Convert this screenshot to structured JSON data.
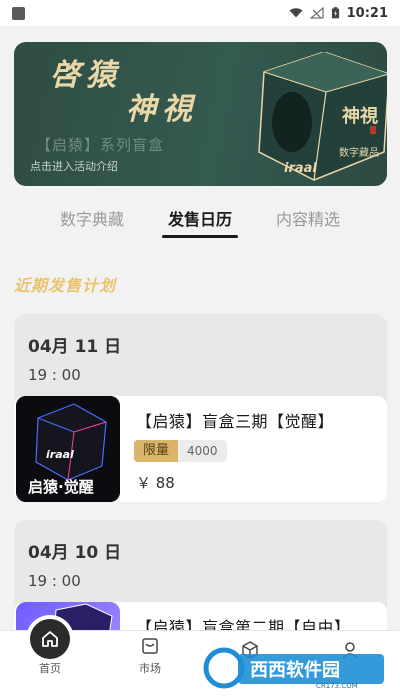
{
  "status_bar": {
    "time": "10:21"
  },
  "banner": {
    "title_line1": "啓猿",
    "title_line2": "神視",
    "subtitle": "【启猿】系列盲盒",
    "hint": "点击进入活动介绍",
    "cube_text_1": "神視",
    "cube_text_2": "数字藏品",
    "cube_brand": "iraal"
  },
  "tabs": [
    {
      "label": "数字典藏",
      "active": false
    },
    {
      "label": "发售日历",
      "active": true
    },
    {
      "label": "内容精选",
      "active": false
    }
  ],
  "section_title": "近期发售计划",
  "schedule": [
    {
      "date": "04月 11 日",
      "time": "19 : 00",
      "item": {
        "title": "【启猿】盲盒三期【觉醒】",
        "badge": "限量",
        "count": "4000",
        "price": "￥ 88",
        "thumb_text": "启猿·觉醒",
        "thumb_brand": "iraal"
      }
    },
    {
      "date": "04月 10 日",
      "time": "19 : 00",
      "item": {
        "title": "【启猿】盲盒第二期【自由】"
      }
    }
  ],
  "bottom_nav": [
    {
      "label": "首页",
      "icon": "home-icon"
    },
    {
      "label": "市场",
      "icon": "market-icon"
    },
    {
      "label": "",
      "icon": "cube-icon"
    },
    {
      "label": "",
      "icon": "user-icon"
    }
  ],
  "watermark": {
    "text": "西西软件园",
    "url_text": "CR173.COM"
  },
  "colors": {
    "accent_gold": "#e8c46e",
    "banner_green": "#2e4d44",
    "badge_gold": "#d9b46a"
  }
}
